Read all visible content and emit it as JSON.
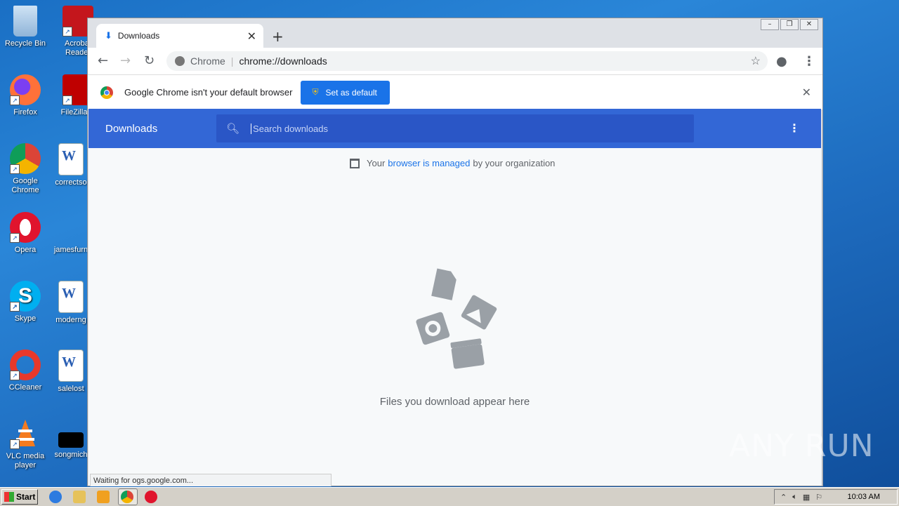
{
  "desktop": {
    "icons": [
      {
        "label": "Recycle Bin"
      },
      {
        "label": "Acrobat Reader"
      },
      {
        "label": "Firefox"
      },
      {
        "label": "FileZilla C"
      },
      {
        "label": "Google Chrome"
      },
      {
        "label": "correctso"
      },
      {
        "label": "Opera"
      },
      {
        "label": "jamesfurn"
      },
      {
        "label": "Skype"
      },
      {
        "label": "moderng"
      },
      {
        "label": "CCleaner"
      },
      {
        "label": "salelost"
      },
      {
        "label": "VLC media player"
      },
      {
        "label": "songmich"
      }
    ]
  },
  "browser": {
    "tab_title": "Downloads",
    "omnibox": {
      "chip": "Chrome",
      "url": "chrome://downloads"
    },
    "infobar": {
      "message": "Google Chrome isn't your default browser",
      "button": "Set as default"
    },
    "downloads": {
      "title": "Downloads",
      "search_placeholder": "Search downloads",
      "managed_prefix": "Your",
      "managed_link": "browser is managed",
      "managed_suffix": "by your organization",
      "empty_message": "Files you download appear here"
    },
    "status_text": "Waiting for ogs.google.com..."
  },
  "taskbar": {
    "start_label": "Start",
    "clock": "10:03 AM"
  },
  "watermark": "ANY RUN"
}
